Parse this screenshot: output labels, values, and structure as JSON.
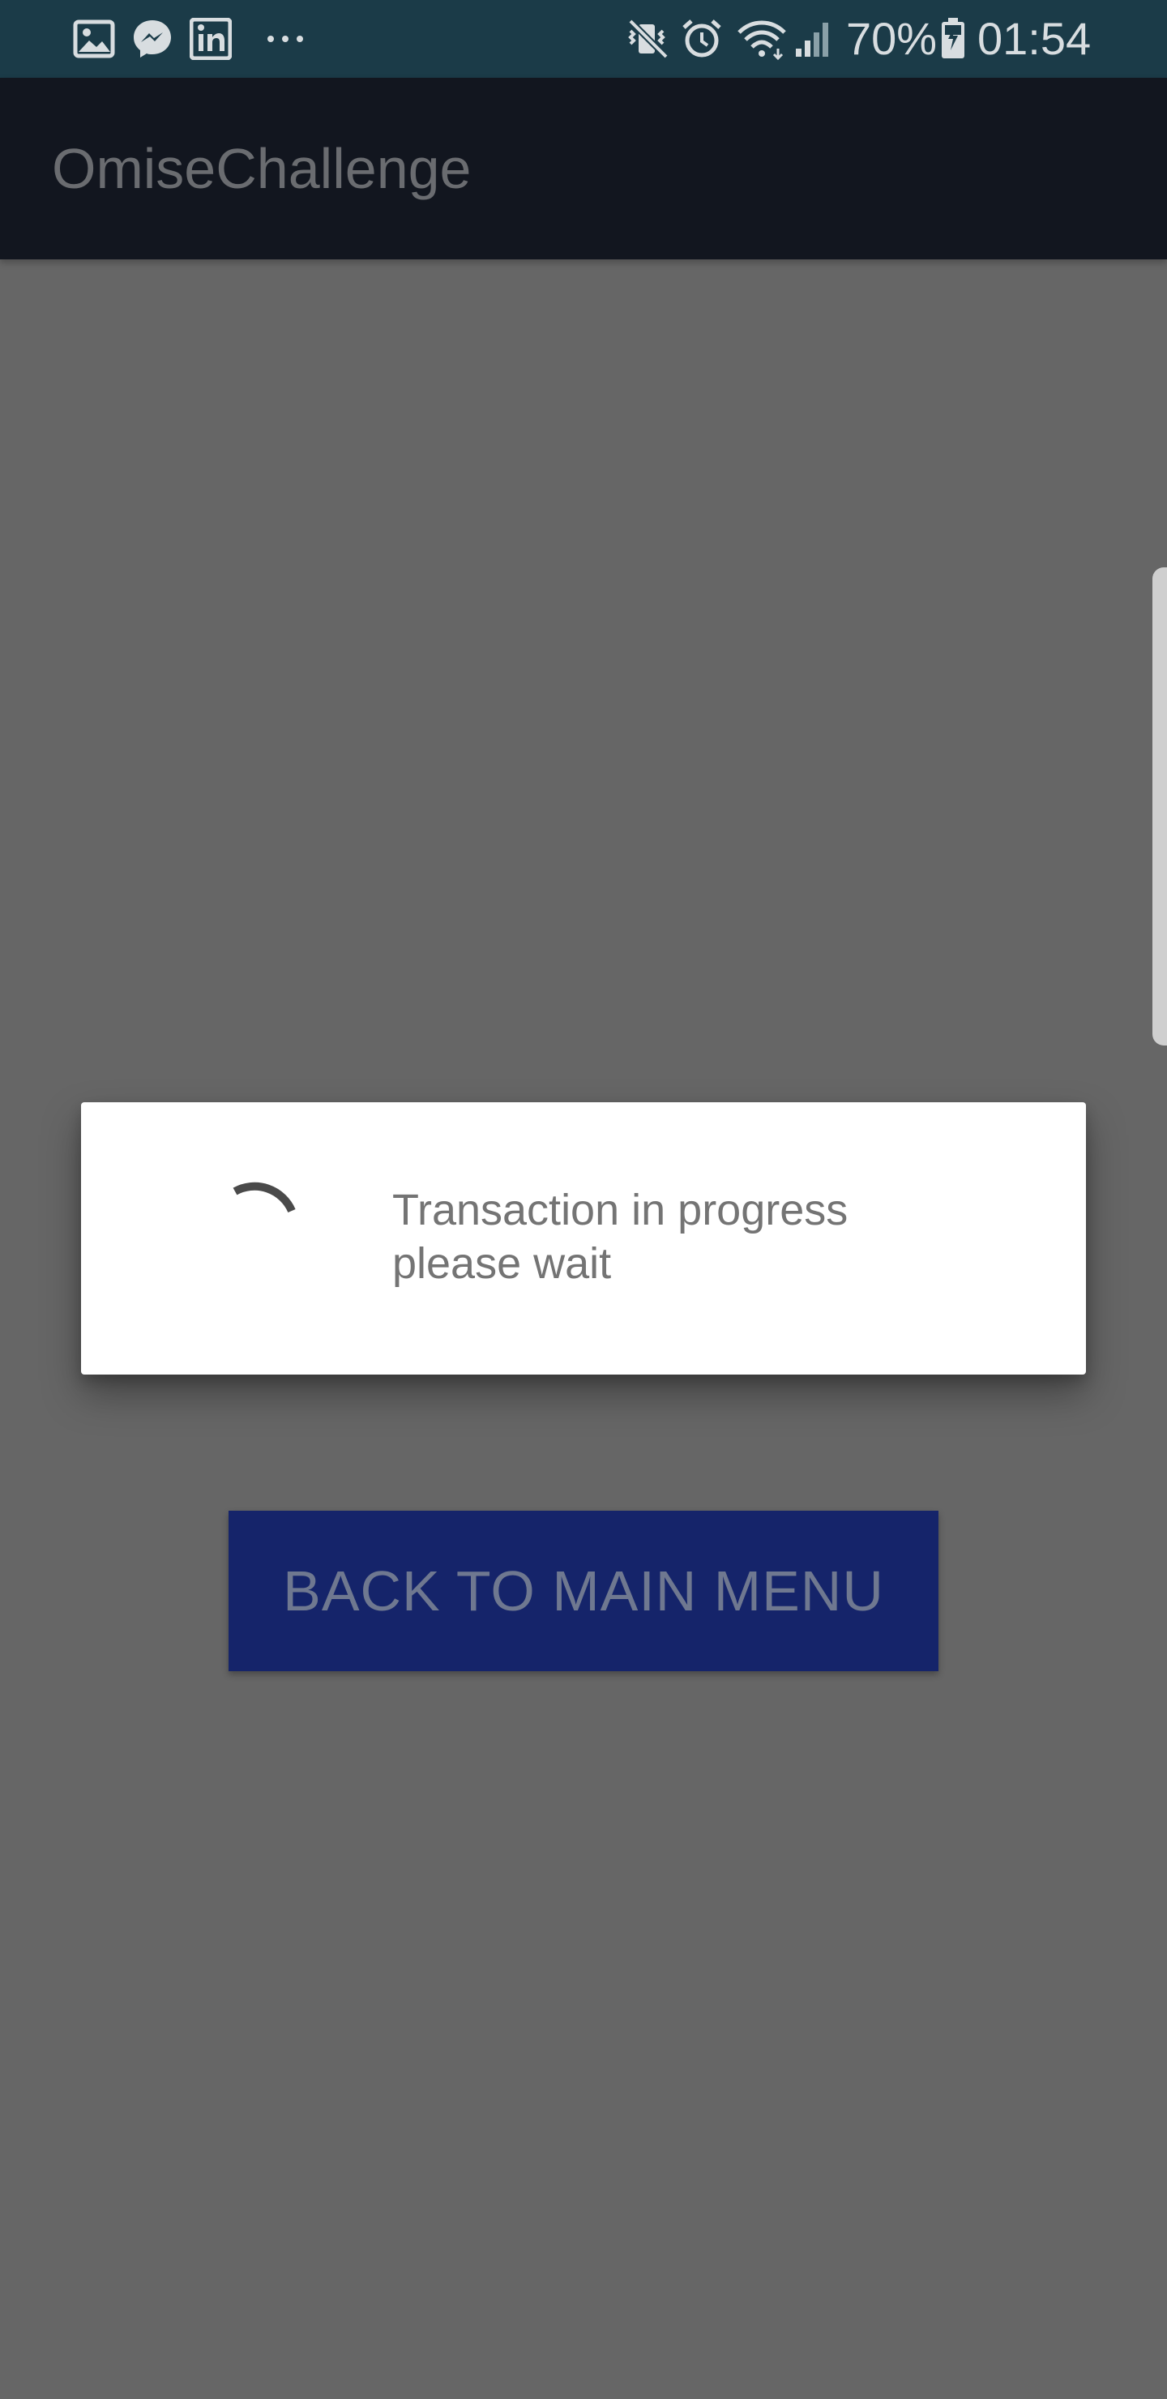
{
  "status_bar": {
    "notification_icons": [
      "gallery-icon",
      "messenger-icon",
      "linkedin-icon",
      "more-dots-icon"
    ],
    "system_icons": [
      "vibrate-mute-icon",
      "alarm-icon",
      "wifi-icon",
      "signal-icon",
      "battery-charging-icon"
    ],
    "battery_level": "70%",
    "time": "01:54",
    "background_color": "#1b3b48"
  },
  "app_bar": {
    "title": "OmiseChallenge",
    "background_color": "#12161f"
  },
  "main": {
    "back_button_label": "BACK TO MAIN MENU",
    "button_color": "#15246a",
    "scrim_color": "#666666"
  },
  "dialog": {
    "message_line1": "Transaction in progress",
    "message_line2": "please wait",
    "indicator_icon": "loading-spinner-icon"
  }
}
